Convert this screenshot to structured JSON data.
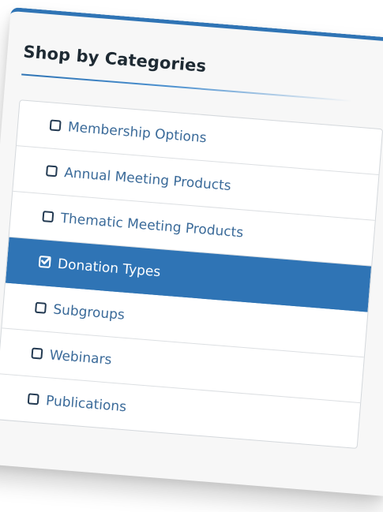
{
  "panel": {
    "title": "Shop by Categories",
    "categories": [
      {
        "label": "Membership Options",
        "checked": false
      },
      {
        "label": "Annual Meeting Products",
        "checked": false
      },
      {
        "label": "Thematic Meeting Products",
        "checked": false
      },
      {
        "label": "Donation Types",
        "checked": true
      },
      {
        "label": "Subgroups",
        "checked": false
      },
      {
        "label": "Webinars",
        "checked": false
      },
      {
        "label": "Publications",
        "checked": false
      }
    ]
  },
  "colors": {
    "accent": "#2f74b5",
    "link_text": "#3a6a99",
    "checkbox_border": "#233a52"
  },
  "icons": {
    "unchecked": "checkbox-unchecked-icon",
    "checked": "checkbox-checked-icon"
  }
}
